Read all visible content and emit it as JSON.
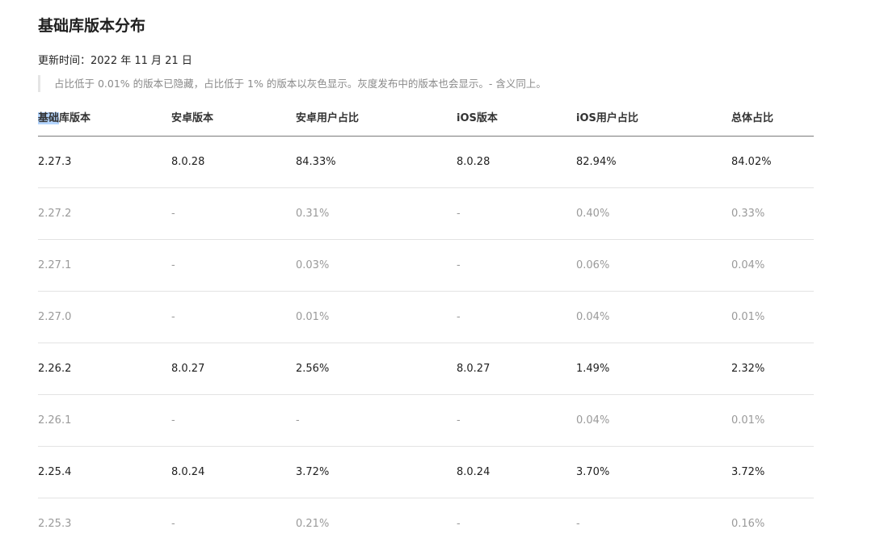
{
  "title": "基础库版本分布",
  "updated": "更新时间：2022 年 11 月 21 日",
  "note": "占比低于 0.01% 的版本已隐藏，占比低于 1% 的版本以灰色显示。灰度发布中的版本也会显示。- 含义同上。",
  "table": {
    "headers": {
      "base_selected": "基础",
      "base_rest": "库版本",
      "android_version": "安卓版本",
      "android_share": "安卓用户占比",
      "ios_version": "iOS版本",
      "ios_share": "iOS用户占比",
      "total_share": "总体占比"
    },
    "rows": [
      {
        "base": "2.27.3",
        "android": "8.0.28",
        "android_share": "84.33%",
        "ios": "8.0.28",
        "ios_share": "82.94%",
        "total": "84.02%",
        "highlight": true
      },
      {
        "base": "2.27.2",
        "android": "-",
        "android_share": "0.31%",
        "ios": "-",
        "ios_share": "0.40%",
        "total": "0.33%",
        "highlight": false
      },
      {
        "base": "2.27.1",
        "android": "-",
        "android_share": "0.03%",
        "ios": "-",
        "ios_share": "0.06%",
        "total": "0.04%",
        "highlight": false
      },
      {
        "base": "2.27.0",
        "android": "-",
        "android_share": "0.01%",
        "ios": "-",
        "ios_share": "0.04%",
        "total": "0.01%",
        "highlight": false
      },
      {
        "base": "2.26.2",
        "android": "8.0.27",
        "android_share": "2.56%",
        "ios": "8.0.27",
        "ios_share": "1.49%",
        "total": "2.32%",
        "highlight": true
      },
      {
        "base": "2.26.1",
        "android": "-",
        "android_share": "-",
        "ios": "-",
        "ios_share": "0.04%",
        "total": "0.01%",
        "highlight": false
      },
      {
        "base": "2.25.4",
        "android": "8.0.24",
        "android_share": "3.72%",
        "ios": "8.0.24",
        "ios_share": "3.70%",
        "total": "3.72%",
        "highlight": true
      },
      {
        "base": "2.25.3",
        "android": "-",
        "android_share": "0.21%",
        "ios": "-",
        "ios_share": "-",
        "total": "0.16%",
        "highlight": false
      }
    ]
  }
}
